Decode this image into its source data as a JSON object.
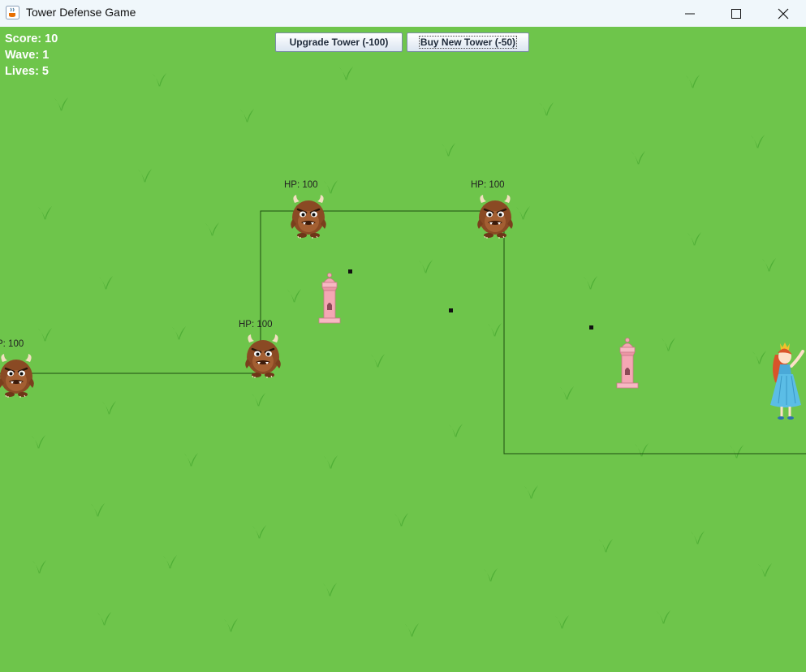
{
  "window": {
    "title": "Tower Defense Game",
    "icon": "java-cup-icon",
    "controls": [
      "minimize-icon",
      "maximize-icon",
      "close-icon"
    ]
  },
  "hud": {
    "score": "Score: 10",
    "wave": "Wave: 1",
    "lives": "Lives: 5"
  },
  "buttons": {
    "upgrade_tower": "Upgrade Tower (-100)",
    "buy_new_tower": "Buy New Tower (-50)"
  },
  "monsters": [
    {
      "hp_label": "P: 100"
    },
    {
      "hp_label": "HP: 100"
    },
    {
      "hp_label": "HP: 100"
    },
    {
      "hp_label": "HP: 100"
    }
  ],
  "towers": [
    {
      "name": "tower-1"
    },
    {
      "name": "tower-2"
    }
  ],
  "colors": {
    "grass": "#6ec54b",
    "grass_tuft": "#4fae36",
    "path_line": "#1d4d12",
    "monster_fur": "#8a4a24",
    "tower_pink": "#f4a7b4",
    "hud_text": "#ffffff"
  }
}
